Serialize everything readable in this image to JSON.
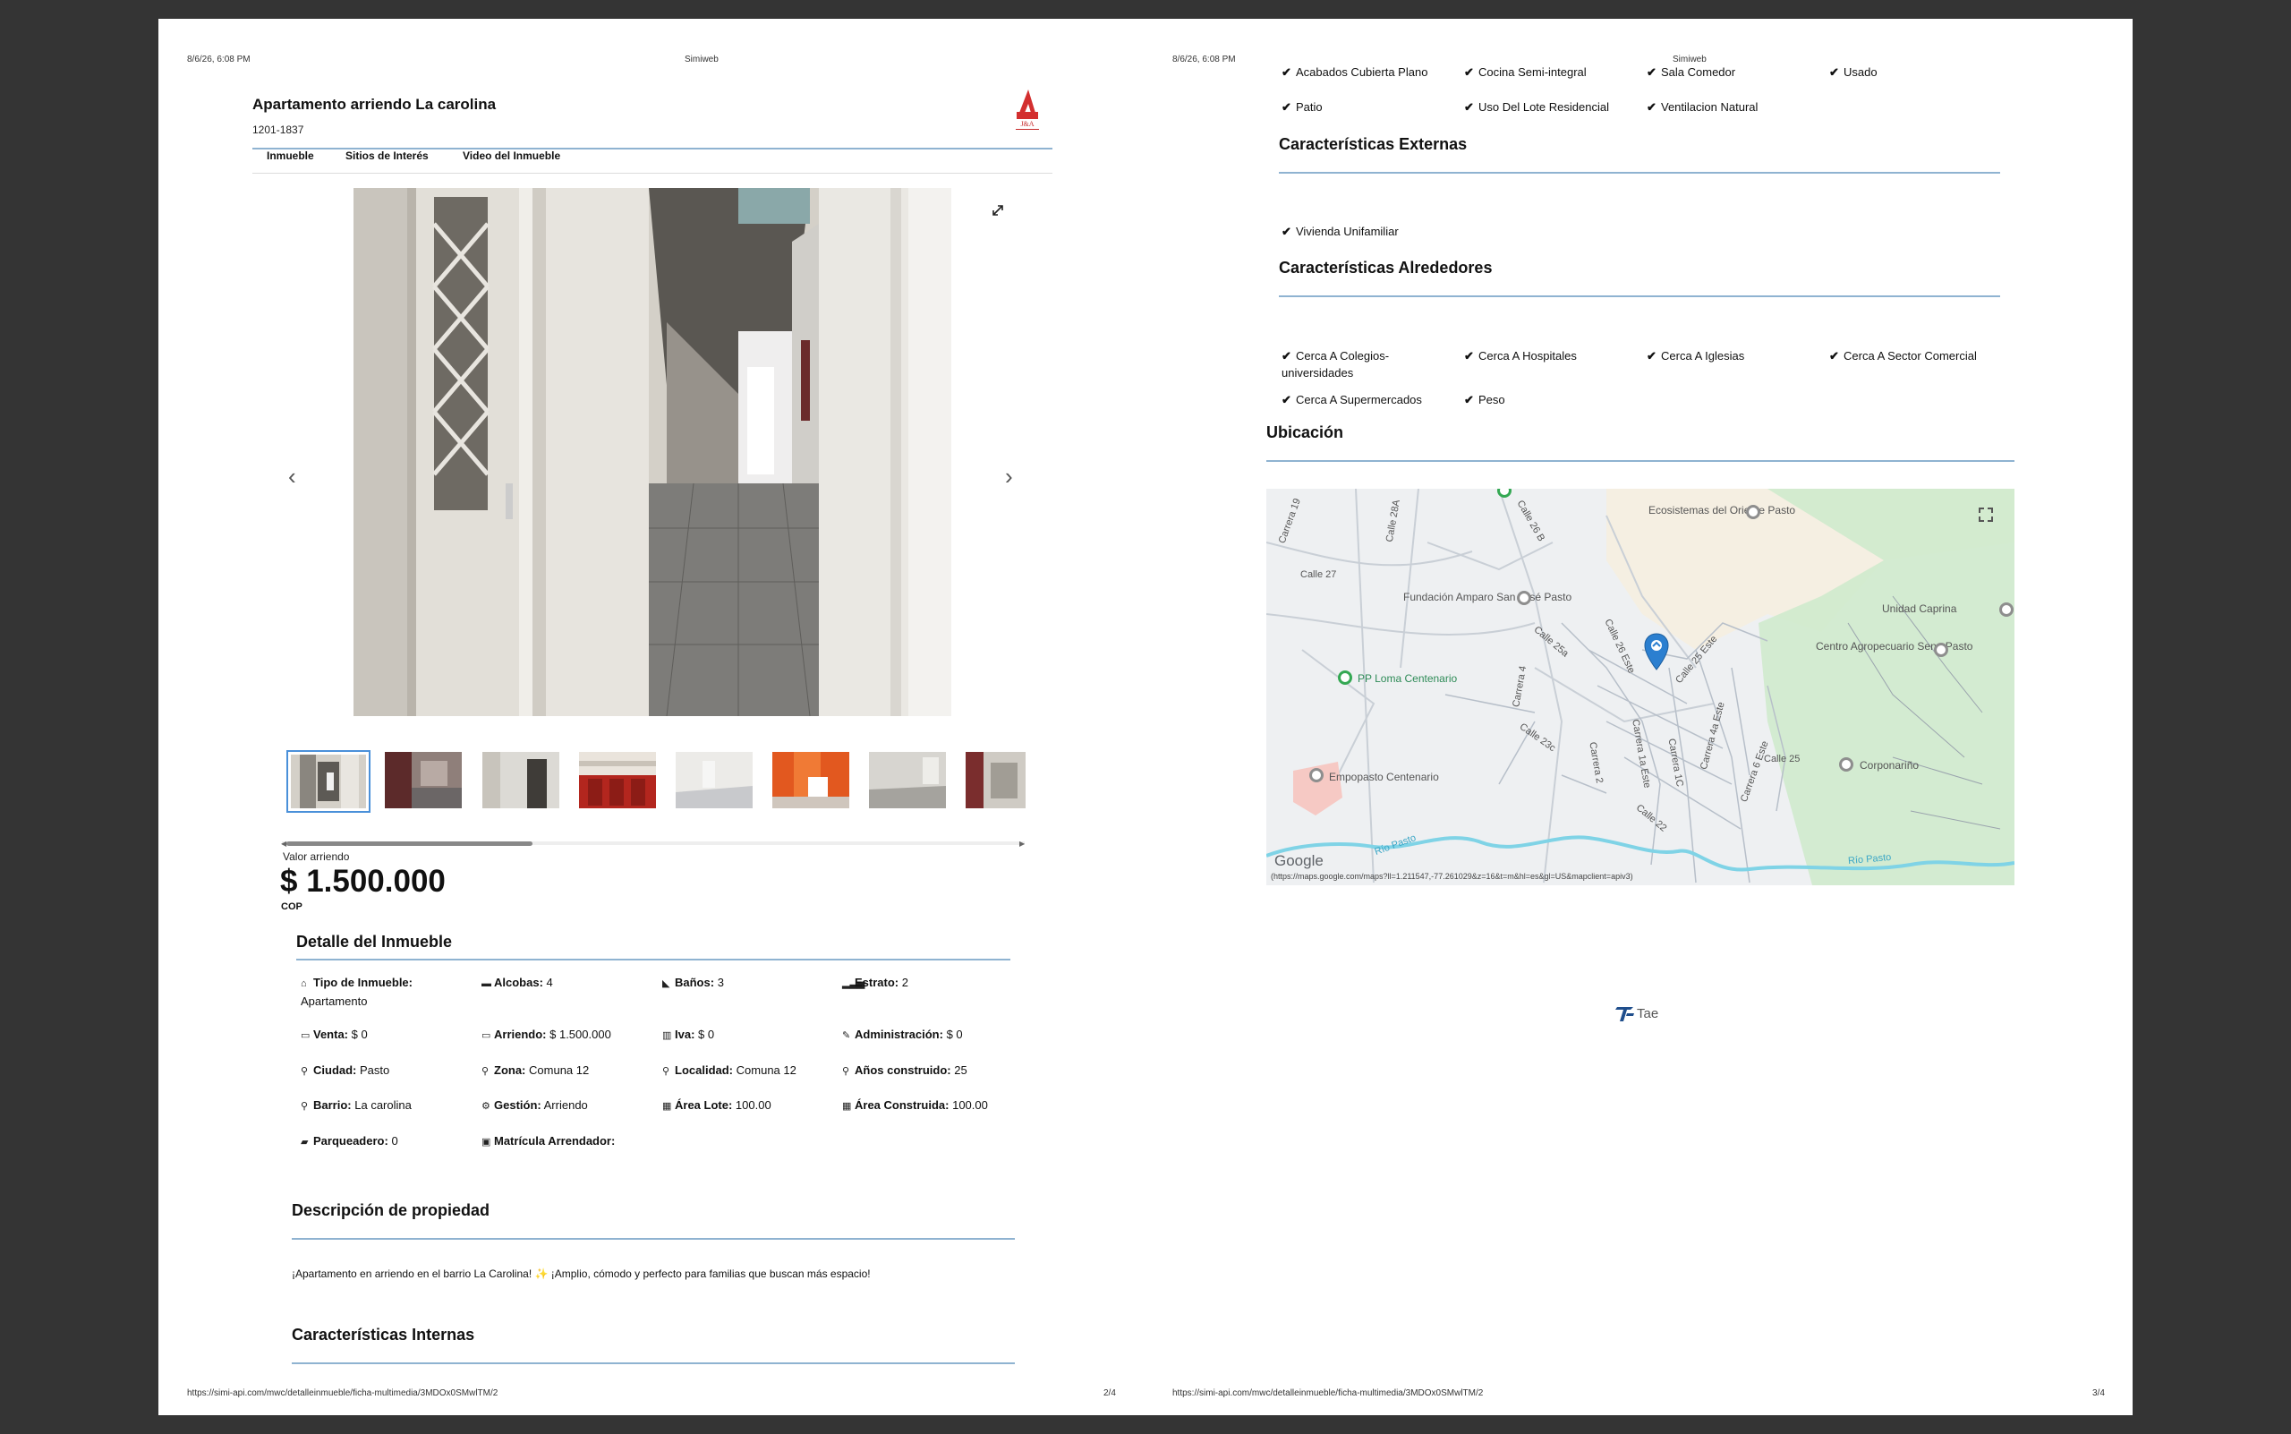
{
  "left_page": {
    "header_datetime": "8/6/26, 6:08 PM",
    "header_site": "Simiweb",
    "title": "Apartamento arriendo La carolina",
    "code": "1201-1837",
    "logo_text": "J&A",
    "tabs": [
      "Inmueble",
      "Sitios de Interés",
      "Video del Inmueble"
    ],
    "expand_icon": "expand-icon",
    "prev_arrow": "‹",
    "next_arrow": "›",
    "price_label": "Valor arriendo",
    "price": "$ 1.500.000",
    "currency": "COP",
    "detail_title": "Detalle del Inmueble",
    "details": [
      {
        "label": "Tipo de Inmueble:",
        "value": "Apartamento",
        "icon": "home-icon",
        "glyph": "⌂"
      },
      {
        "label": "Alcobas:",
        "value": "4",
        "icon": "bed-icon",
        "glyph": "▬"
      },
      {
        "label": "Baños:",
        "value": "3",
        "icon": "bath-icon",
        "glyph": "◣"
      },
      {
        "label": "Estrato:",
        "value": "2",
        "icon": "signal-icon",
        "glyph": "▂▃▅"
      },
      {
        "label": "Venta:",
        "value": "$ 0",
        "icon": "money-icon",
        "glyph": "▭"
      },
      {
        "label": "Arriendo:",
        "value": "$ 1.500.000",
        "icon": "money-icon",
        "glyph": "▭"
      },
      {
        "label": "Iva:",
        "value": "$ 0",
        "icon": "barcode-icon",
        "glyph": "▥"
      },
      {
        "label": "Administración:",
        "value": "$ 0",
        "icon": "wrench-icon",
        "glyph": "✎"
      },
      {
        "label": "Ciudad:",
        "value": "Pasto",
        "icon": "map-marker-icon",
        "glyph": "⚲"
      },
      {
        "label": "Zona:",
        "value": "Comuna 12",
        "icon": "map-marker-icon",
        "glyph": "⚲"
      },
      {
        "label": "Localidad:",
        "value": "Comuna 12",
        "icon": "map-marker-icon",
        "glyph": "⚲"
      },
      {
        "label": "Años construido:",
        "value": "25",
        "icon": "map-marker-icon",
        "glyph": "⚲"
      },
      {
        "label": "Barrio:",
        "value": "La carolina",
        "icon": "map-marker-icon",
        "glyph": "⚲"
      },
      {
        "label": "Gestión:",
        "value": "Arriendo",
        "icon": "cogs-icon",
        "glyph": "⚙"
      },
      {
        "label": "Área Lote:",
        "value": "100.00",
        "icon": "th-large-icon",
        "glyph": "▦"
      },
      {
        "label": "Área Construida:",
        "value": "100.00",
        "icon": "th-large-icon",
        "glyph": "▦"
      },
      {
        "label": "Parqueadero:",
        "value": "0",
        "icon": "car-icon",
        "glyph": "▰"
      },
      {
        "label": "Matrícula Arrendador:",
        "value": "",
        "icon": "id-card-icon",
        "glyph": "▣"
      }
    ],
    "description_title": "Descripción de propiedad",
    "description": "¡Apartamento en arriendo en el barrio La Carolina! ✨ ¡Amplio, cómodo y perfecto para familias que buscan más espacio!",
    "internal_title": "Características Internas",
    "footer_url": "https://simi-api.com/mwc/detalleinmueble/ficha-multimedia/3MDOx0SMwlTM/2",
    "footer_page": "2/4"
  },
  "right_page": {
    "header_datetime": "8/6/26, 6:08 PM",
    "header_site": "Simiweb",
    "internal_features": [
      "Acabados Cubierta Plano",
      "Cocina Semi-integral",
      "Sala Comedor",
      "Usado",
      "Patio",
      "Uso Del Lote Residencial",
      "Ventilacion Natural"
    ],
    "external_title": "Características Externas",
    "external_features": [
      "Vivienda Unifamiliar"
    ],
    "surroundings_title": "Características Alrededores",
    "surroundings_features": [
      "Cerca A Colegios-universidades",
      "Cerca A Hospitales",
      "Cerca A Iglesias",
      "Cerca A Sector Comercial",
      "Cerca A Supermercados",
      "Peso"
    ],
    "location_title": "Ubicación",
    "map": {
      "places": [
        "Ecosistemas del Oriente Pasto",
        "Fundación Amparo San José Pasto",
        "Unidad Caprina",
        "Centro Agropecuario Sena Pasto",
        "PP Loma Centenario",
        "Empopasto Centenario",
        "Corponariño"
      ],
      "streets": [
        "Calle 28A",
        "Carrera 19",
        "Calle 26 B",
        "Calle 27",
        "Calle 25a",
        "Calle 25 Este",
        "Calle 26 Este",
        "Carrera 4",
        "Calle 23c",
        "Carrera 2",
        "Carrera 1a Este",
        "Carrera 1C",
        "Carrera 4a Este",
        "Carrera 6 Este",
        "Calle 22",
        "Calle 25",
        "Río Pasto"
      ],
      "google": "Google",
      "url": "(https://maps.google.com/maps?ll=1.211547,-77.261029&z=16&t=m&hl=es&gl=US&mapclient=apiv3)"
    },
    "logo_text": "Tae",
    "footer_url": "https://simi-api.com/mwc/detalleinmueble/ficha-multimedia/3MDOx0SMwlTM/2",
    "footer_page": "3/4"
  }
}
